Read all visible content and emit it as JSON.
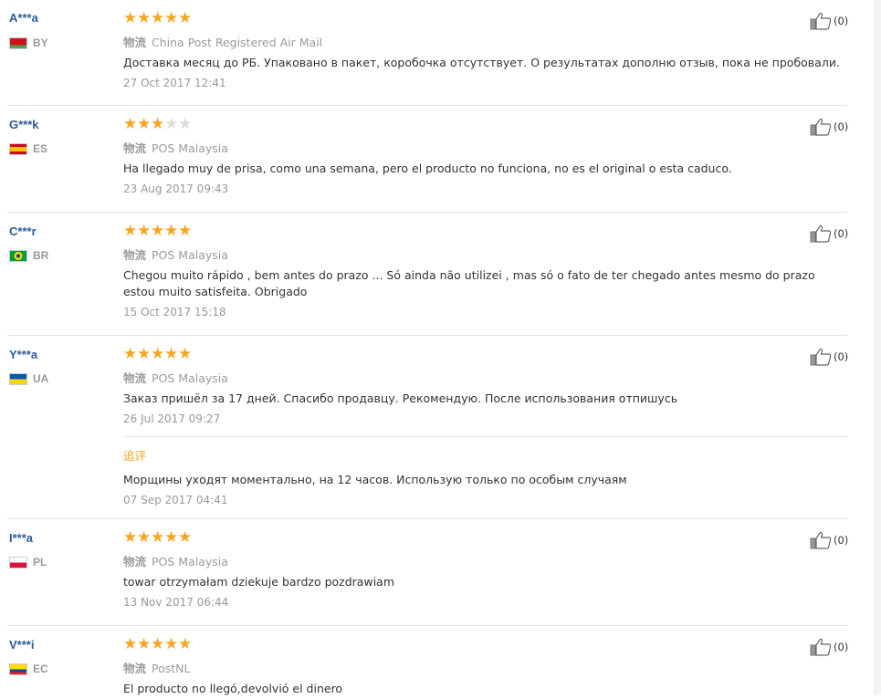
{
  "shipping_tag": "物流",
  "followup_label": "追评",
  "reviews": [
    {
      "user": "A***a",
      "country": "BY",
      "stars": 5,
      "shipping": "China Post Registered Air Mail",
      "text": "Доставка месяц до РБ. Упаковано в пакет, коробочка отсутствует. О результатах дополню отзыв, пока не пробовали.",
      "date": "27 Oct 2017 12:41",
      "likes": "(0)"
    },
    {
      "user": "G***k",
      "country": "ES",
      "stars": 3,
      "shipping": "POS Malaysia",
      "text": "Ha llegado muy de prisa, como una semana, pero el producto no funciona, no es el original o esta caduco.",
      "date": "23 Aug 2017 09:43",
      "likes": "(0)"
    },
    {
      "user": "C***r",
      "country": "BR",
      "stars": 5,
      "shipping": "POS Malaysia",
      "text": "Chegou muito rápido , bem antes do prazo ... Só ainda não utilizei , mas só o fato de ter chegado antes mesmo do prazo estou muito satisfeita. Obrigado",
      "date": "15 Oct 2017 15:18",
      "likes": "(0)"
    },
    {
      "user": "Y***a",
      "country": "UA",
      "stars": 5,
      "shipping": "POS Malaysia",
      "text": "Заказ пришёл за 17 дней. Спасибо продавцу. Рекомендую. После использования отпишусь",
      "date": "26 Jul 2017 09:27",
      "likes": "(0)",
      "followup": {
        "text": "Морщины уходят моментально, на 12 часов. Использую только по особым случаям",
        "date": "07 Sep 2017 04:41"
      }
    },
    {
      "user": "I***a",
      "country": "PL",
      "stars": 5,
      "shipping": "POS Malaysia",
      "text": "towar otrzymałam dziekuje bardzo pozdrawiam",
      "date": "13 Nov 2017 06:44",
      "likes": "(0)"
    },
    {
      "user": "V***i",
      "country": "EC",
      "stars": 5,
      "shipping": "PostNL",
      "text": "El producto no llegó,devolvió el dinero",
      "date": "",
      "likes": "(0)"
    }
  ],
  "colors": {
    "star": "#f5a623",
    "username": "#2d5b98",
    "muted": "#999999"
  }
}
